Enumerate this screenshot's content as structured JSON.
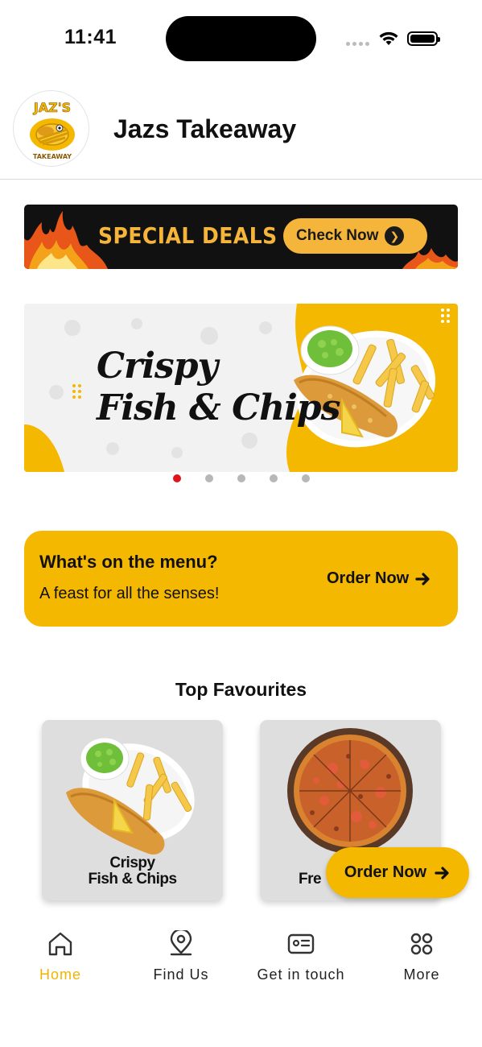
{
  "status_bar": {
    "time": "11:41"
  },
  "header": {
    "title": "Jazs Takeaway",
    "logo_text": "JAZ'S",
    "logo_subtext": "TAKEAWAY"
  },
  "deals_banner": {
    "title": "SPECIAL DEALS",
    "button_label": "Check Now"
  },
  "carousel": {
    "slide_title_line1": "Crispy",
    "slide_title_line2": "Fish & Chips",
    "slide_count": 5,
    "active_index": 0,
    "accent_color": "#f5b800"
  },
  "menu_card": {
    "title": "What's on the menu?",
    "subtitle": "A feast for all the senses!",
    "cta_label": "Order Now"
  },
  "favourites": {
    "heading": "Top Favourites",
    "items": [
      {
        "name": "Crispy\nFish & Chips",
        "icon": "fish-and-chips-image"
      },
      {
        "name": "Fre",
        "icon": "pizza-image"
      }
    ]
  },
  "fab": {
    "label": "Order Now"
  },
  "tab_bar": {
    "active_color": "#f0b400",
    "items": [
      {
        "label": "Home",
        "icon": "home-icon",
        "active": true
      },
      {
        "label": "Find Us",
        "icon": "location-pin-icon",
        "active": false
      },
      {
        "label": "Get in touch",
        "icon": "contact-card-icon",
        "active": false
      },
      {
        "label": "More",
        "icon": "grid-icon",
        "active": false
      }
    ]
  }
}
